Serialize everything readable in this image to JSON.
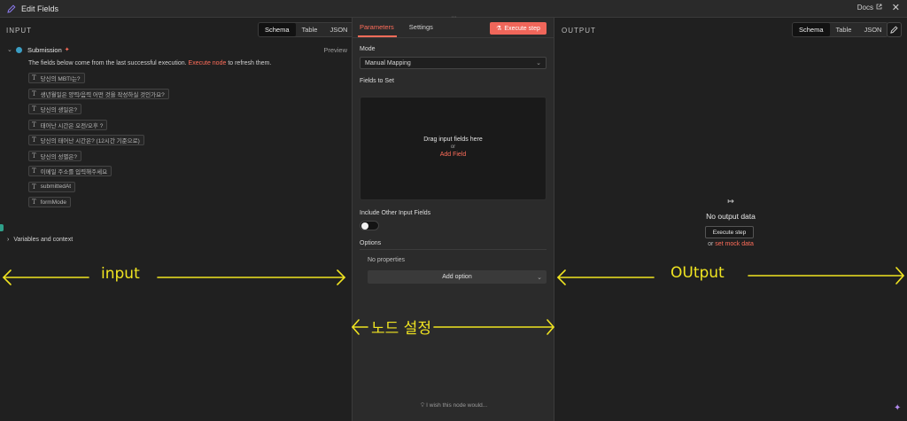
{
  "titlebar": {
    "title": "Edit Fields",
    "docs": "Docs"
  },
  "input": {
    "section_title": "INPUT",
    "tabs": [
      "Schema",
      "Table",
      "JSON"
    ],
    "node_name": "Submission",
    "preview": "Preview",
    "note_before": "The fields below come from the last successful execution.",
    "note_link": "Execute node",
    "note_after": "to refresh them.",
    "fields": [
      "당신의 MBTI는?",
      "생년월일은 양력/음력 어떤 것을 작성하실 것인가요?",
      "당신의 생일은?",
      "태어난 시간은 오전/오후 ?",
      "당신의 태어난 시간은? (12시간 기준으로)",
      "당신의 성별은?",
      "이메일 주소를 입력해주세요",
      "submittedAt",
      "formMode"
    ],
    "variables": "Variables and context"
  },
  "middle": {
    "tab_parameters": "Parameters",
    "tab_settings": "Settings",
    "execute": "Execute step",
    "mode_label": "Mode",
    "mode_value": "Manual Mapping",
    "fields_label": "Fields to Set",
    "drop_text": "Drag input fields here",
    "drop_or": "or",
    "drop_link": "Add Field",
    "include_label": "Include Other Input Fields",
    "options_label": "Options",
    "no_props": "No properties",
    "add_option": "Add option",
    "wish": "I wish this node would..."
  },
  "output": {
    "section_title": "OUTPUT",
    "tabs": [
      "Schema",
      "Table",
      "JSON"
    ],
    "empty_title": "No output data",
    "execute_btn": "Execute step",
    "or_text": "or",
    "mock_link": "set mock data"
  },
  "annotations": {
    "input": "input",
    "output": "OUtput",
    "node_settings": "노드 설정"
  },
  "colors": {
    "accent": "#ff6d5a",
    "annotation": "#f0e421"
  }
}
